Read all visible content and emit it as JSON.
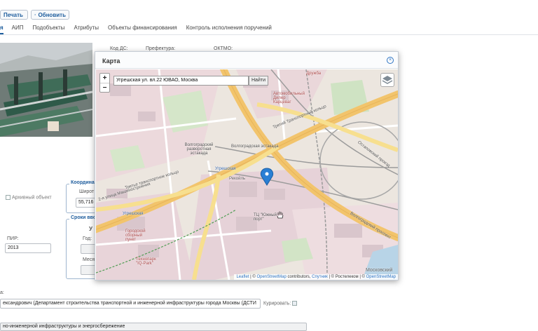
{
  "toolbar": {
    "print_label": "Печать",
    "refresh_label": "Обновить"
  },
  "tabs": [
    {
      "label": "я",
      "active": true
    },
    {
      "label": "АИП",
      "active": false
    },
    {
      "label": "Подобъекты",
      "active": false
    },
    {
      "label": "Атрибуты",
      "active": false
    },
    {
      "label": "Объекты финансирования",
      "active": false
    },
    {
      "label": "Контроль исполнения поручений",
      "active": false
    }
  ],
  "form": {
    "kod_ds_label": "Код ДС:",
    "prefecture_label": "Префектура:",
    "oktmo_label": "ОКТМО:",
    "archive_label": "Архивный объект",
    "pir_label": "ПИР:",
    "pir_value": "2013",
    "coords_legend": "Координа",
    "lat_label": "Широт",
    "lat_value": "55,716",
    "terms_legend": "Сроки вво",
    "terms_sub": "У",
    "year_label": "Год:",
    "month_label": "Месяц",
    "bottom_label": "а:",
    "customer_value": "ександрович (Департамент строительства транспортной и инженерной инфраструктуры города Москвы (ДСТИ",
    "curate_label": "Курировать:",
    "bottom_value": "но-инженерной инфраструктуры и энергосбережение"
  },
  "modal": {
    "title": "Карта",
    "search_value": "Угрешская ул. вл.22 ЮВАО, Москва",
    "find_label": "Найти",
    "zoom_in": "+",
    "zoom_out": "−",
    "attribution": {
      "leaflet": "Leaflet",
      "sep1": " | © ",
      "osm": "OpenStreetMap",
      "contrib": " contributors, ",
      "sputnik": "Спутник",
      "rest": " | © Ростелеком | © ",
      "osm2": "OpenStreetMap"
    },
    "map_labels": [
      "Волгоградский разворотная эстакада",
      "Волгоградская эстакада",
      "Угрешская",
      "Третье транспортное кольцо",
      "Третий Транспортный кольцо",
      "Угрешская",
      "Городской сборный пункт",
      "Технопарк \"IQ-Park\"",
      "ТЦ \"Южный порт\"",
      "Остаповский проезд",
      "Волгоградский проспект",
      "Московский",
      "Дружба",
      "Автомобильный Дилер Карцеваг",
      "2-я улица Машиностроения",
      "Рекойль"
    ]
  }
}
